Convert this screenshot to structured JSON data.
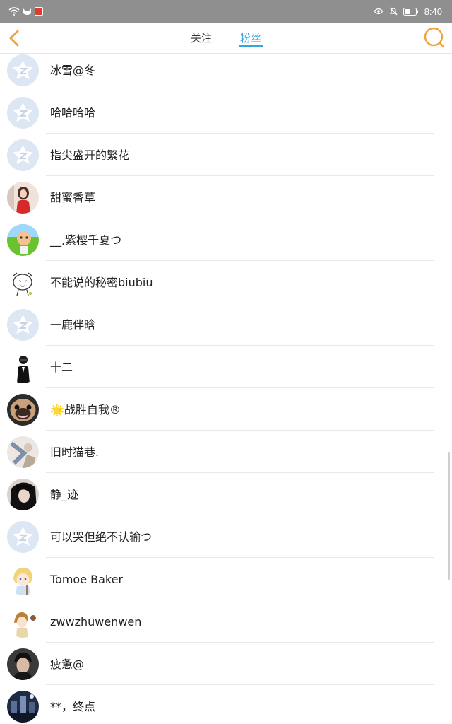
{
  "status_bar": {
    "time": "8:40",
    "colors": {
      "background": "#8f8f8f",
      "foreground": "#ffffff"
    }
  },
  "nav": {
    "tabs": [
      {
        "label": "关注",
        "active": false
      },
      {
        "label": "粉丝",
        "active": true
      }
    ],
    "accent_color": "#36a4dd",
    "icon_color": "#f0a33d"
  },
  "followers": [
    {
      "name": "冰雪@冬",
      "avatar": "default-star"
    },
    {
      "name": "哈哈哈哈",
      "avatar": "default-star"
    },
    {
      "name": "指尖盛开的繁花",
      "avatar": "default-star"
    },
    {
      "name": "甜蜜香草",
      "avatar": "photo-woman-red"
    },
    {
      "name": "__,紫樱千夏つ",
      "avatar": "cartoon-green"
    },
    {
      "name": "不能说的秘密biubiu",
      "avatar": "cartoon-sketch"
    },
    {
      "name": "一鹿伴晗",
      "avatar": "default-star"
    },
    {
      "name": "十二",
      "avatar": "figure-suit"
    },
    {
      "name": "战胜自我®",
      "avatar": "pug",
      "prefix_emoji": "🌟"
    },
    {
      "name": "旧时猫巷.",
      "avatar": "photo-pale"
    },
    {
      "name": "静_迹",
      "avatar": "photo-dark-hair"
    },
    {
      "name": "可以哭但绝不认输つ",
      "avatar": "default-star"
    },
    {
      "name": "Tomoe Baker",
      "avatar": "anime-blonde"
    },
    {
      "name": "zwwzhuwenwen",
      "avatar": "anime-brown"
    },
    {
      "name": "疲惫@",
      "avatar": "photo-boy"
    },
    {
      "name": "**，终点",
      "avatar": "photo-night"
    }
  ]
}
